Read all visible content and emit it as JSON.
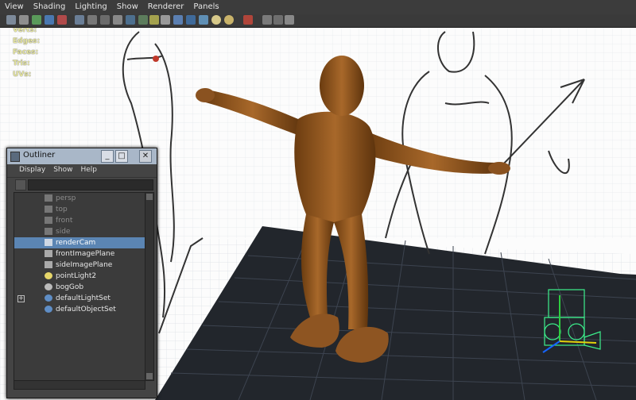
{
  "menubar": {
    "items": [
      "View",
      "Shading",
      "Lighting",
      "Show",
      "Renderer",
      "Panels"
    ]
  },
  "hud": {
    "labels": [
      "Verts:",
      "Edges:",
      "Faces:",
      "Tris:",
      "UVs:"
    ]
  },
  "outliner": {
    "title": "Outliner",
    "menu": [
      "Display",
      "Show",
      "Help"
    ],
    "items": [
      {
        "label": "persp",
        "icon": "camera-icon",
        "dim": true,
        "selected": false
      },
      {
        "label": "top",
        "icon": "camera-icon",
        "dim": true,
        "selected": false
      },
      {
        "label": "front",
        "icon": "camera-icon",
        "dim": true,
        "selected": false
      },
      {
        "label": "side",
        "icon": "camera-icon",
        "dim": true,
        "selected": false
      },
      {
        "label": "renderCam",
        "icon": "camera-icon",
        "dim": false,
        "selected": true
      },
      {
        "label": "frontImagePlane",
        "icon": "camera-icon",
        "dim": false,
        "selected": false
      },
      {
        "label": "sideImagePlane",
        "icon": "camera-icon",
        "dim": false,
        "selected": false
      },
      {
        "label": "pointLight2",
        "icon": "light-icon",
        "dim": false,
        "selected": false
      },
      {
        "label": "bogGob",
        "icon": "joint-icon",
        "dim": false,
        "selected": false
      },
      {
        "label": "defaultLightSet",
        "icon": "set-icon",
        "dim": false,
        "selected": false,
        "expand": true
      },
      {
        "label": "defaultObjectSet",
        "icon": "set-icon",
        "dim": false,
        "selected": false
      }
    ]
  },
  "colors": {
    "selected_row": "#5b85b3",
    "model_skin": "#9a5e1e",
    "grid_floor": "#22262c",
    "camera_wire": "#3cf08c"
  }
}
